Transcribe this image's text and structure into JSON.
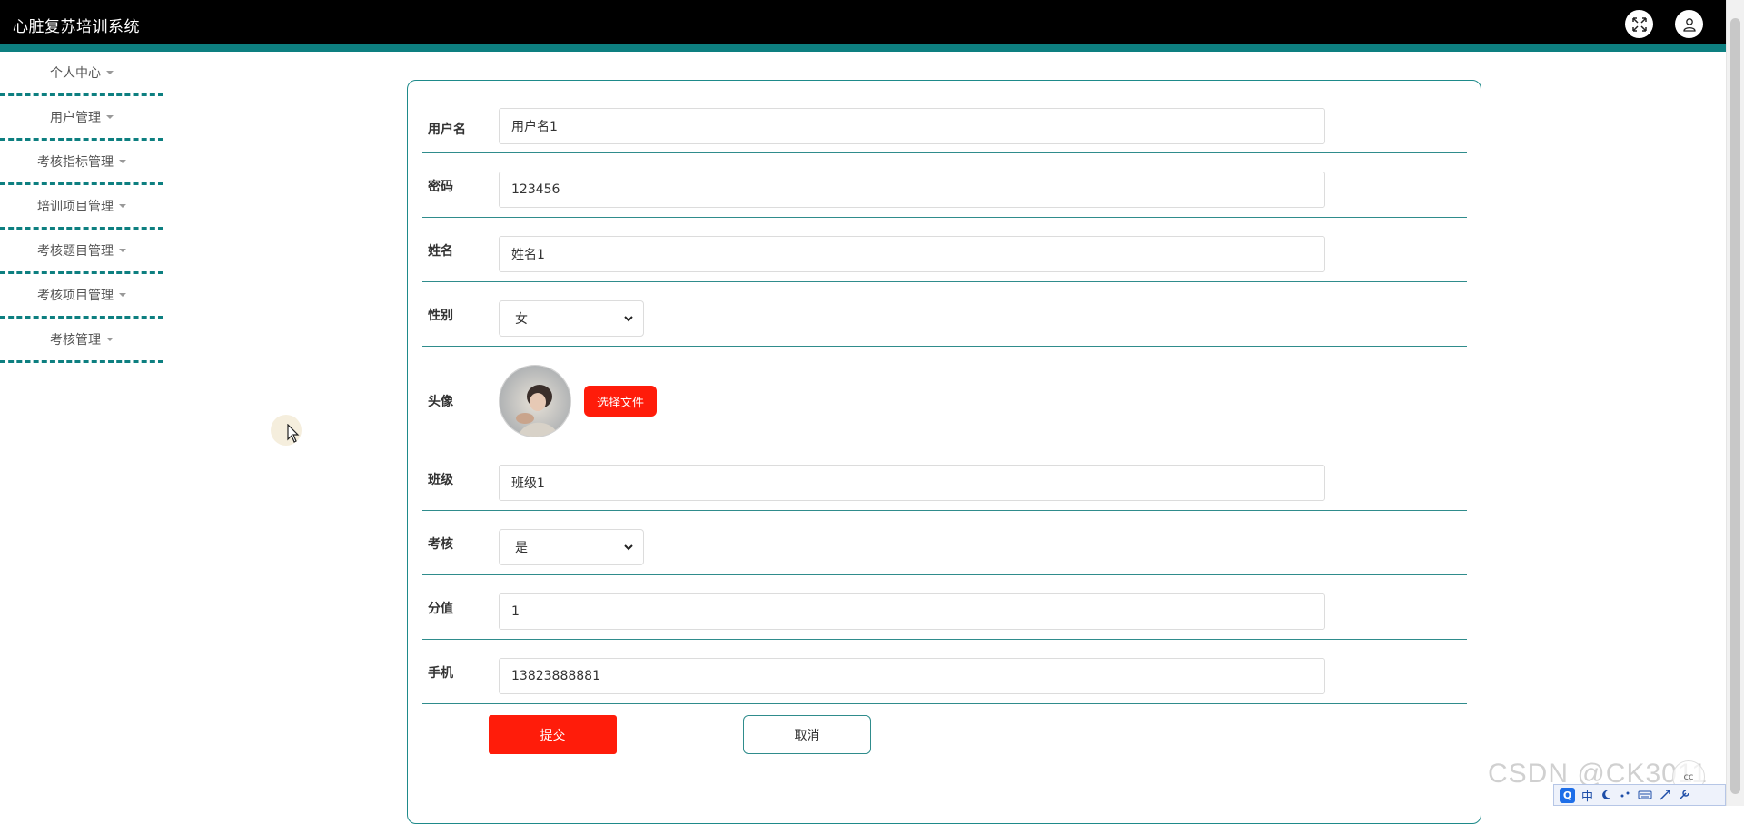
{
  "header": {
    "title": "心脏复苏培训系统",
    "fullscreen_icon": "expand-icon",
    "user_icon": "user-icon",
    "bar_color": "#000000",
    "accent_color": "#0d7f80"
  },
  "sidebar": {
    "items": [
      {
        "label": "个人中心"
      },
      {
        "label": "用户管理"
      },
      {
        "label": "考核指标管理"
      },
      {
        "label": "培训项目管理"
      },
      {
        "label": "考核题目管理"
      },
      {
        "label": "考核项目管理"
      },
      {
        "label": "考核管理"
      }
    ]
  },
  "form": {
    "username": {
      "label": "用户名",
      "value": "用户名1"
    },
    "password": {
      "label": "密码",
      "value": "123456"
    },
    "name": {
      "label": "姓名",
      "value": "姓名1"
    },
    "gender": {
      "label": "性别",
      "value": "女"
    },
    "avatar": {
      "label": "头像",
      "button_label": "选择文件"
    },
    "class": {
      "label": "班级",
      "value": "班级1"
    },
    "assessment": {
      "label": "考核",
      "value": "是"
    },
    "score": {
      "label": "分值",
      "value": "1"
    },
    "phone": {
      "label": "手机",
      "value": "13823888881"
    },
    "submit_label": "提交",
    "cancel_label": "取消",
    "primary_color": "#ff1c0a"
  },
  "overlay": {
    "watermark": "CSDN @CK3011",
    "ime_mode": "中",
    "ime_logo": "Q",
    "cc_label": "cc"
  }
}
